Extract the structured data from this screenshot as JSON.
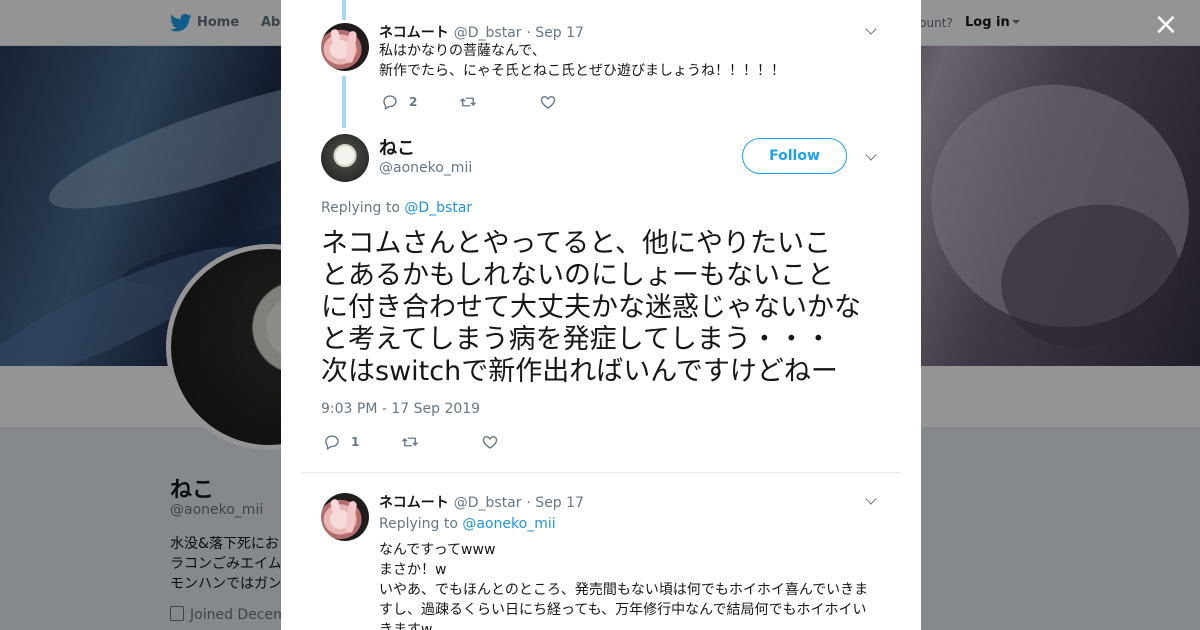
{
  "nav": {
    "home": "Home",
    "about": "Abo",
    "account_question": "ccount?",
    "login": "Log in"
  },
  "profile": {
    "name": "ねこ",
    "handle": "@aoneko_mii",
    "bio": [
      "水没&落下死にお",
      "ラコンごみエイム",
      "モンハンではガン"
    ],
    "joined": "Joined Decem"
  },
  "modal": {
    "close_label": "×",
    "tweet1": {
      "author": "ネコムート",
      "handle": "@D_bstar",
      "date": "· Sep 17",
      "text": "私はかなりの菩薩なんで、\n新作でたら、にゃそ氏とねこ氏とぜひ遊びましょうね！！！！！",
      "reply_count": "2",
      "retweet_count": "",
      "like_count": ""
    },
    "main_tweet": {
      "author": "ねこ",
      "handle": "@aoneko_mii",
      "follow_label": "Follow",
      "replying_prefix": "Replying to ",
      "replying_to": "@D_bstar",
      "text": "ネコムさんとやってると、他にやりたいこ\nとあるかもしれないのにしょーもないこと\nに付き合わせて大丈夫かな迷惑じゃないかな\nと考えてしまう病を発症してしまう・・・\n次はswitchで新作出ればいんですけどねー",
      "timestamp": "9:03 PM - 17 Sep 2019",
      "reply_count": "1",
      "retweet_count": "",
      "like_count": ""
    },
    "tweet3": {
      "author": "ネコムート",
      "handle": "@D_bstar",
      "date": "· Sep 17",
      "replying_prefix": "Replying to ",
      "replying_to": "@aoneko_mii",
      "text": "なんですってwww\nまさか！w\nいやあ、でもほんとのところ、発売間もない頃は何でもホイホイ喜んでいきま\nすし、過疎るくらい日にち経っても、万年修行中なんで結局何でもホイホイい\nきますw"
    }
  },
  "colors": {
    "accent": "#1da1f2",
    "link": "#1b95e0",
    "thread_line": "#a6d8f5",
    "secondary_text": "#657786"
  }
}
